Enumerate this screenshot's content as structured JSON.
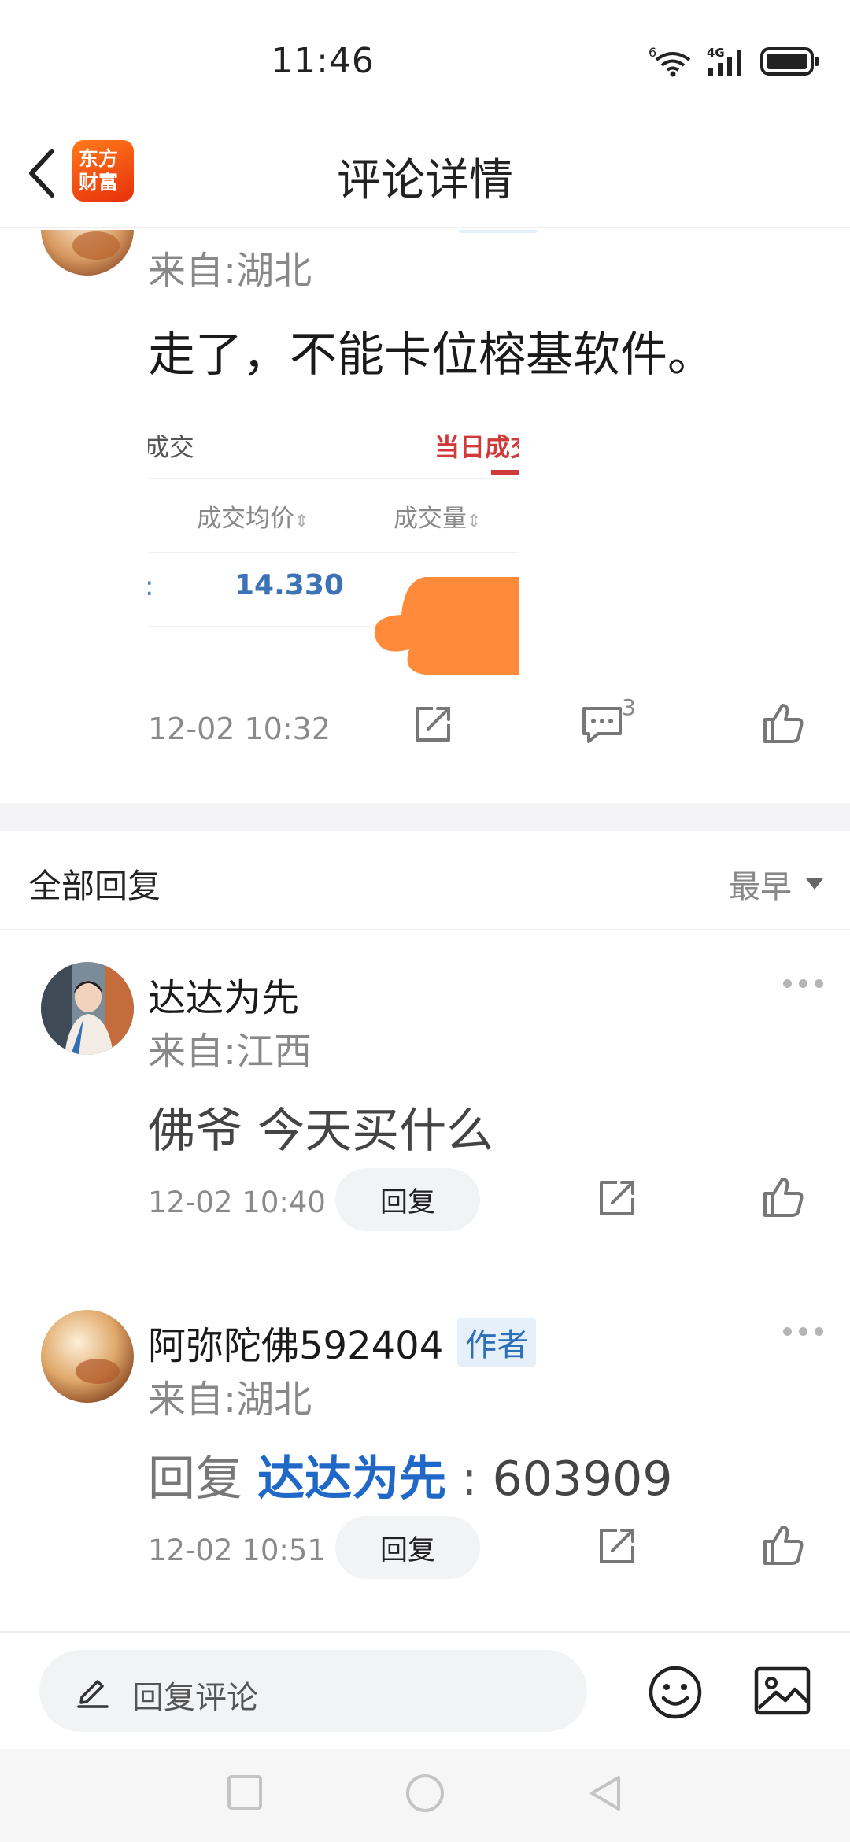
{
  "status_bar": {
    "time": "11:46",
    "wifi_label": "6",
    "network_label": "4G",
    "icons": [
      "wifi-icon",
      "signal-icon",
      "battery-icon"
    ]
  },
  "nav": {
    "title": "评论详情",
    "logo_line1": "东方",
    "logo_line2": "财富",
    "back_icon": "chevron-left-icon"
  },
  "post": {
    "region": "来自:湖北",
    "text": "走了，不能卡位榕基软件。",
    "image": {
      "tab_left": "l成交",
      "tab_right": "当日成交",
      "col1": "成交均价",
      "col2": "成交量",
      "value": "14.330"
    },
    "time": "12-02 10:32",
    "comment_count": "3"
  },
  "replies": {
    "title": "全部回复",
    "sort": "最早",
    "items": [
      {
        "name": "达达为先",
        "region": "来自:江西",
        "text": "佛爷 今天买什么",
        "time": "12-02 10:40",
        "reply_label": "回复"
      },
      {
        "name": "阿弥陀佛592404",
        "badge": "作者",
        "region": "来自:湖北",
        "reply_prefix": "回复",
        "reply_target": "达达为先",
        "reply_sep": ":",
        "text": "603909",
        "time": "12-02 10:51",
        "reply_label": "回复"
      }
    ]
  },
  "input_bar": {
    "placeholder": "回复评论",
    "icons": [
      "pencil-icon",
      "emoji-icon",
      "image-icon"
    ]
  },
  "system_nav": {
    "icons": [
      "recent-apps-icon",
      "home-icon",
      "back-triangle-icon"
    ]
  },
  "colors": {
    "accent_blue": "#2068c7",
    "brand_orange": "#ff6a13",
    "red": "#d03a3a"
  }
}
